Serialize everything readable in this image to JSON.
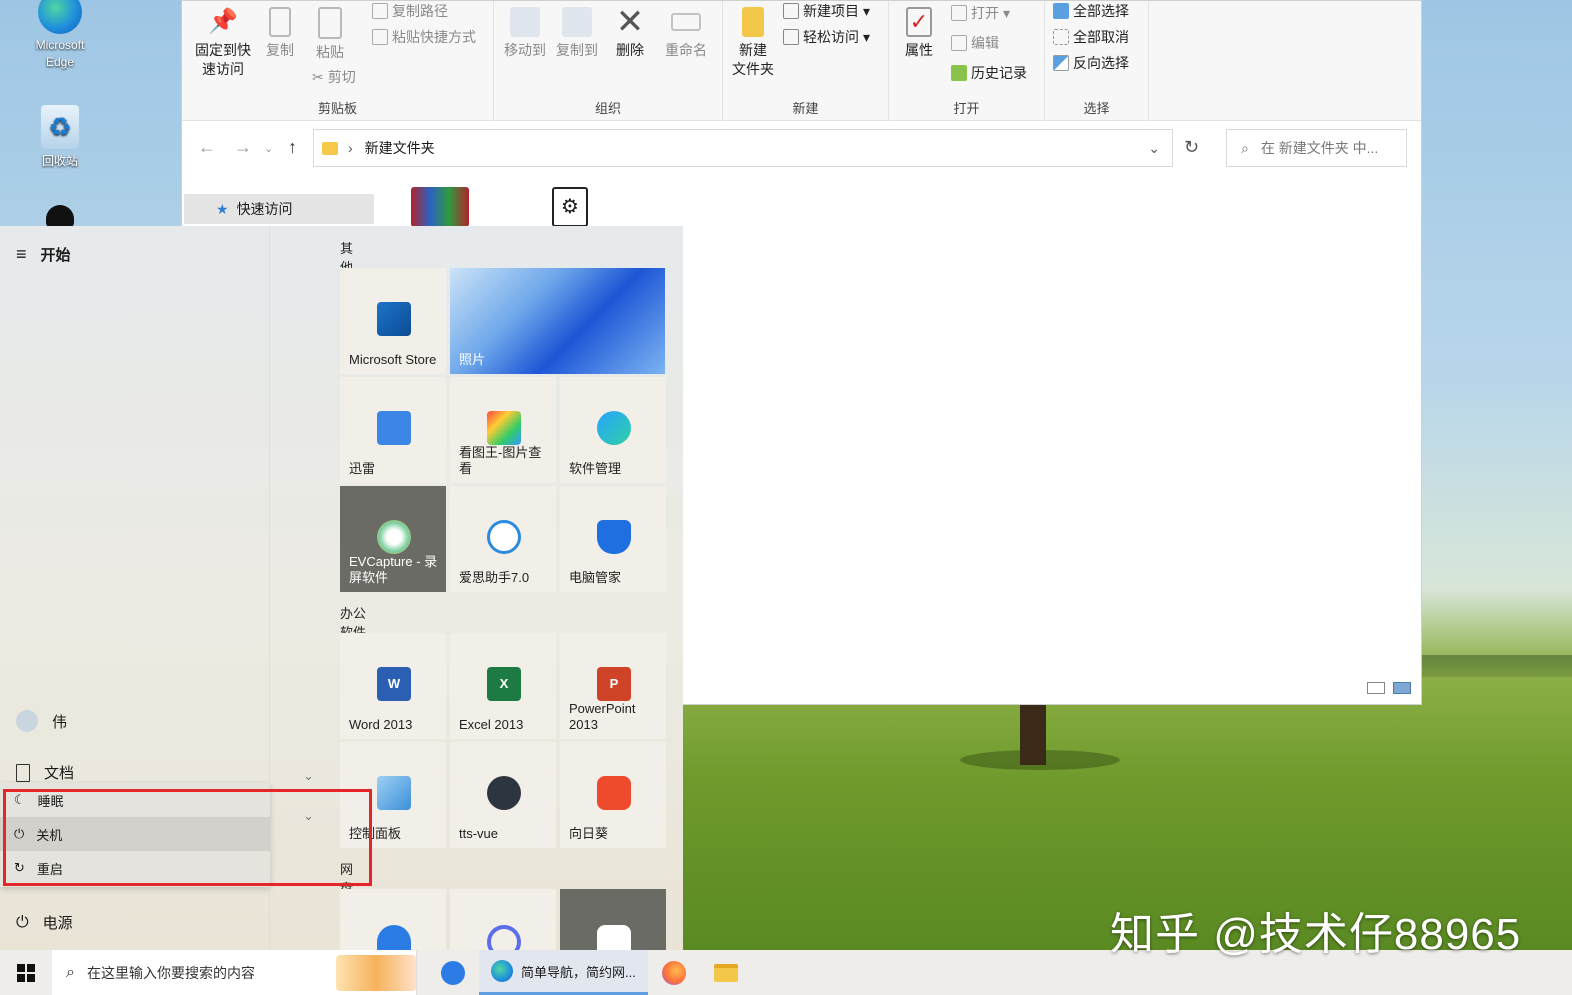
{
  "desktop": {
    "icons": [
      {
        "label": "Microsoft\nEdge"
      },
      {
        "label": "回收站"
      }
    ]
  },
  "explorer": {
    "ribbon": {
      "groups": [
        {
          "title": "剪贴板"
        },
        {
          "title": "组织"
        },
        {
          "title": "新建"
        },
        {
          "title": "打开"
        },
        {
          "title": "选择"
        }
      ],
      "pin_label": "固定到快\n速访问",
      "copy_label": "复制",
      "paste_label": "粘贴",
      "copy_path": "复制路径",
      "paste_shortcut": "粘贴快捷方式",
      "cut": "剪切",
      "move_to": "移动到",
      "copy_to": "复制到",
      "delete": "删除",
      "rename": "重命名",
      "new_folder": "新建\n文件夹",
      "new_item": "新建项目",
      "easy_access": "轻松访问",
      "properties": "属性",
      "open": "打开",
      "edit": "编辑",
      "history": "历史记录",
      "select_all": "全部选择",
      "select_none": "全部取消",
      "invert_select": "反向选择"
    },
    "address": {
      "path": "新建文件夹"
    },
    "search": {
      "placeholder": "在 新建文件夹 中..."
    },
    "nav": {
      "quick_access": "快速访问"
    }
  },
  "start_menu": {
    "title": "开始",
    "user": "伟",
    "documents": "文档",
    "power_options": [
      {
        "label": "睡眠",
        "icon": "moon-icon"
      },
      {
        "label": "关机",
        "icon": "power-icon"
      },
      {
        "label": "重启",
        "icon": "restart-icon"
      }
    ],
    "power": "电源",
    "sections": {
      "other": "其他软件",
      "office": "办公软件office",
      "netdisk": "网盘"
    },
    "tiles": {
      "store": "Microsoft Store",
      "photos": "照片",
      "xunlei": "迅雷",
      "kantuwang": "看图王-图片查看",
      "software_mgr": "软件管理",
      "evcapture": "EVCapture - 录屏软件",
      "aisi": "爱思助手7.0",
      "pc_manager": "电脑管家",
      "word": "Word 2013",
      "excel": "Excel 2013",
      "powerpoint": "PowerPoint 2013",
      "control_panel": "控制面板",
      "tts_vue": "tts-vue",
      "sunflower": "向日葵"
    }
  },
  "taskbar": {
    "search_placeholder": "在这里输入你要搜索的内容",
    "active_app": "简单导航，简约网..."
  },
  "watermark": "知乎 @技术仔88965"
}
